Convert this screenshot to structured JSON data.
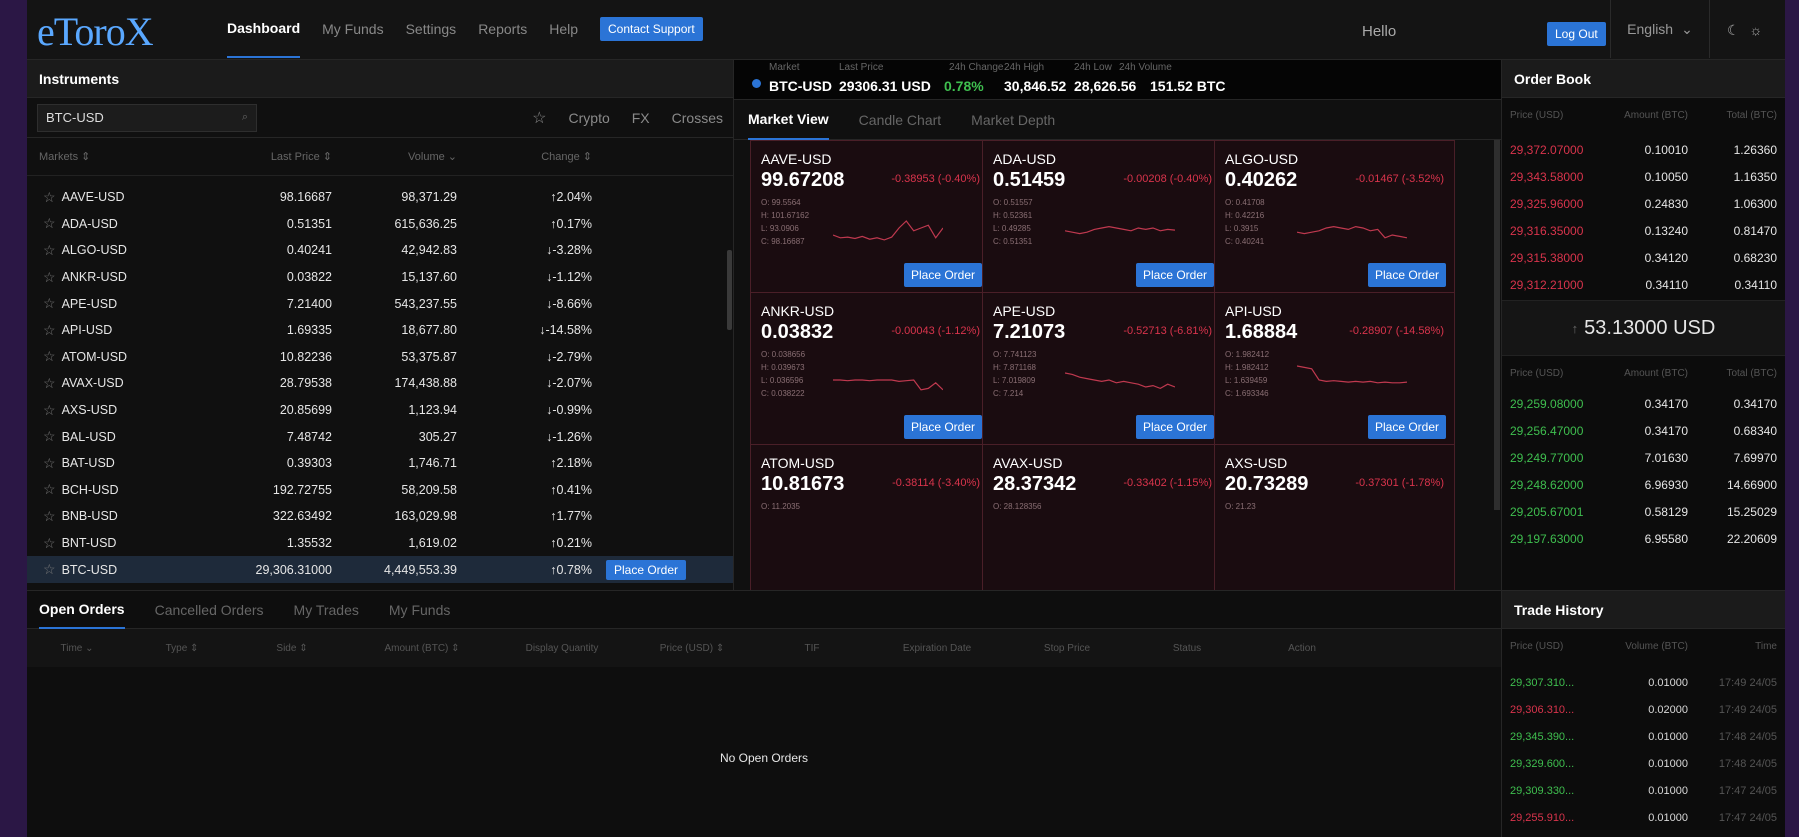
{
  "app": {
    "logo": "eToroX"
  },
  "nav": {
    "items": [
      "Dashboard",
      "My Funds",
      "Settings",
      "Reports",
      "Help"
    ],
    "contact": "Contact Support",
    "hello": "Hello",
    "logout": "Log Out",
    "language": "English"
  },
  "instruments": {
    "title": "Instruments",
    "search_value": "BTC-USD",
    "filters": [
      "Crypto",
      "FX",
      "Crosses"
    ],
    "columns": [
      "Markets ⇕",
      "Last Price ⇕",
      "Volume ⌄",
      "Change ⇕"
    ],
    "rows": [
      {
        "m": "AAVE-USD",
        "p": "98.16687",
        "v": "98,371.29",
        "c": "↑2.04%",
        "dir": "up"
      },
      {
        "m": "ADA-USD",
        "p": "0.51351",
        "v": "615,636.25",
        "c": "↑0.17%",
        "dir": "up"
      },
      {
        "m": "ALGO-USD",
        "p": "0.40241",
        "v": "42,942.83",
        "c": "↓-3.28%",
        "dir": "down"
      },
      {
        "m": "ANKR-USD",
        "p": "0.03822",
        "v": "15,137.60",
        "c": "↓-1.12%",
        "dir": "down"
      },
      {
        "m": "APE-USD",
        "p": "7.21400",
        "v": "543,237.55",
        "c": "↓-8.66%",
        "dir": "down"
      },
      {
        "m": "API-USD",
        "p": "1.69335",
        "v": "18,677.80",
        "c": "↓-14.58%",
        "dir": "down"
      },
      {
        "m": "ATOM-USD",
        "p": "10.82236",
        "v": "53,375.87",
        "c": "↓-2.79%",
        "dir": "down"
      },
      {
        "m": "AVAX-USD",
        "p": "28.79538",
        "v": "174,438.88",
        "c": "↓-2.07%",
        "dir": "down"
      },
      {
        "m": "AXS-USD",
        "p": "20.85699",
        "v": "1,123.94",
        "c": "↓-0.99%",
        "dir": "down"
      },
      {
        "m": "BAL-USD",
        "p": "7.48742",
        "v": "305.27",
        "c": "↓-1.26%",
        "dir": "down"
      },
      {
        "m": "BAT-USD",
        "p": "0.39303",
        "v": "1,746.71",
        "c": "↑2.18%",
        "dir": "up"
      },
      {
        "m": "BCH-USD",
        "p": "192.72755",
        "v": "58,209.58",
        "c": "↑0.41%",
        "dir": "up"
      },
      {
        "m": "BNB-USD",
        "p": "322.63492",
        "v": "163,029.98",
        "c": "↑1.77%",
        "dir": "up"
      },
      {
        "m": "BNT-USD",
        "p": "1.35532",
        "v": "1,619.02",
        "c": "↑0.21%",
        "dir": "up"
      },
      {
        "m": "BTC-USD",
        "p": "29,306.31000",
        "v": "4,449,553.39",
        "c": "↑0.78%",
        "dir": "up",
        "selected": true
      }
    ],
    "place_order": "Place Order"
  },
  "ticker": {
    "labels": [
      "Market",
      "Last Price",
      "24h Change",
      "24h High",
      "24h Low",
      "24h Volume"
    ],
    "market": "BTC-USD",
    "last_price": "29306.31 USD",
    "change": "0.78%",
    "high": "30,846.52",
    "low": "28,626.56",
    "volume": "151.52 BTC"
  },
  "market_view": {
    "tabs": [
      "Market View",
      "Candle Chart",
      "Market Depth"
    ],
    "cards": [
      {
        "sym": "AAVE-USD",
        "price": "99.67208",
        "chg": "-0.38953 (-0.40%)",
        "o": "O: 99.5564",
        "h": "H: 101.67162",
        "l": "L: 93.0906",
        "c": "C: 98.16687",
        "spark": [
          40,
          44,
          43,
          45,
          42,
          46,
          44,
          47,
          43,
          30,
          20,
          34,
          30,
          26,
          44,
          30
        ]
      },
      {
        "sym": "ADA-USD",
        "price": "0.51459",
        "chg": "-0.00208 (-0.40%)",
        "o": "O: 0.51557",
        "h": "H: 0.52361",
        "l": "L: 0.49285",
        "c": "C: 0.51351",
        "spark": [
          34,
          36,
          38,
          36,
          32,
          30,
          28,
          30,
          32,
          34,
          30,
          32,
          30,
          34,
          32,
          33
        ]
      },
      {
        "sym": "ALGO-USD",
        "price": "0.40262",
        "chg": "-0.01467 (-3.52%)",
        "o": "O: 0.41708",
        "h": "H: 0.42216",
        "l": "L: 0.3915",
        "c": "C: 0.40241",
        "spark": [
          36,
          38,
          36,
          34,
          30,
          28,
          30,
          32,
          28,
          30,
          34,
          32,
          44,
          40,
          42,
          44
        ]
      },
      {
        "sym": "ANKR-USD",
        "price": "0.03832",
        "chg": "-0.00043 (-1.12%)",
        "o": "O: 0.038656",
        "h": "H: 0.039673",
        "l": "L: 0.036596",
        "c": "C: 0.038222",
        "spark": [
          30,
          30,
          31,
          30,
          30,
          31,
          30,
          30,
          30,
          32,
          31,
          30,
          44,
          42,
          34,
          44
        ]
      },
      {
        "sym": "APE-USD",
        "price": "7.21073",
        "chg": "-0.52713 (-6.81%)",
        "o": "O: 7.741123",
        "h": "H: 7.871168",
        "l": "L: 7.019809",
        "c": "C: 7.214",
        "spark": [
          20,
          22,
          26,
          28,
          30,
          32,
          30,
          34,
          32,
          34,
          36,
          40,
          38,
          42,
          36,
          40
        ]
      },
      {
        "sym": "API-USD",
        "price": "1.68884",
        "chg": "-0.28907 (-14.58%)",
        "o": "O: 1.982412",
        "h": "H: 1.982412",
        "l": "L: 1.639459",
        "c": "C: 1.693346",
        "spark": [
          10,
          12,
          14,
          30,
          32,
          31,
          32,
          33,
          32,
          33,
          32,
          34,
          33,
          34,
          34,
          33
        ]
      },
      {
        "sym": "ATOM-USD",
        "price": "10.81673",
        "chg": "-0.38114 (-3.40%)",
        "o": "O: 11.2035",
        "h": "",
        "l": "",
        "c": "",
        "spark": []
      },
      {
        "sym": "AVAX-USD",
        "price": "28.37342",
        "chg": "-0.33402 (-1.15%)",
        "o": "O: 28.128356",
        "h": "",
        "l": "",
        "c": "",
        "spark": []
      },
      {
        "sym": "AXS-USD",
        "price": "20.73289",
        "chg": "-0.37301 (-1.78%)",
        "o": "O: 21.23",
        "h": "",
        "l": "",
        "c": "",
        "spark": []
      }
    ]
  },
  "order_book": {
    "title": "Order Book",
    "columns": [
      "Price (USD)",
      "Amount (BTC)",
      "Total (BTC)"
    ],
    "asks": [
      {
        "p": "29,372.07000",
        "a": "0.10010",
        "t": "1.26360"
      },
      {
        "p": "29,343.58000",
        "a": "0.10050",
        "t": "1.16350"
      },
      {
        "p": "29,325.96000",
        "a": "0.24830",
        "t": "1.06300"
      },
      {
        "p": "29,316.35000",
        "a": "0.13240",
        "t": "0.81470"
      },
      {
        "p": "29,315.38000",
        "a": "0.34120",
        "t": "0.68230"
      },
      {
        "p": "29,312.21000",
        "a": "0.34110",
        "t": "0.34110"
      }
    ],
    "spread": "53.13000 USD",
    "bids": [
      {
        "p": "29,259.08000",
        "a": "0.34170",
        "t": "0.34170"
      },
      {
        "p": "29,256.47000",
        "a": "0.34170",
        "t": "0.68340"
      },
      {
        "p": "29,249.77000",
        "a": "7.01630",
        "t": "7.69970"
      },
      {
        "p": "29,248.62000",
        "a": "6.96930",
        "t": "14.66900"
      },
      {
        "p": "29,205.67001",
        "a": "0.58129",
        "t": "15.25029"
      },
      {
        "p": "29,197.63000",
        "a": "6.95580",
        "t": "22.20609"
      }
    ]
  },
  "orders": {
    "tabs": [
      "Open Orders",
      "Cancelled Orders",
      "My Trades",
      "My Funds"
    ],
    "columns": [
      "Time ⌄",
      "Type ⇕",
      "Side ⇕",
      "Amount (BTC) ⇕",
      "Display Quantity",
      "Price (USD) ⇕",
      "TIF",
      "Expiration Date",
      "Stop Price",
      "Status",
      "Action"
    ],
    "empty": "No Open Orders"
  },
  "trade_history": {
    "title": "Trade History",
    "columns": [
      "Price (USD)",
      "Volume (BTC)",
      "Time"
    ],
    "rows": [
      {
        "p": "29,307.310...",
        "v": "0.01000",
        "t": "17:49 24/05",
        "dir": "up"
      },
      {
        "p": "29,306.310...",
        "v": "0.02000",
        "t": "17:49 24/05",
        "dir": "down"
      },
      {
        "p": "29,345.390...",
        "v": "0.01000",
        "t": "17:48 24/05",
        "dir": "up"
      },
      {
        "p": "29,329.600...",
        "v": "0.01000",
        "t": "17:48 24/05",
        "dir": "up"
      },
      {
        "p": "29,309.330...",
        "v": "0.01000",
        "t": "17:47 24/05",
        "dir": "up"
      },
      {
        "p": "29,255.910...",
        "v": "0.01000",
        "t": "17:47 24/05",
        "dir": "down"
      }
    ]
  },
  "colors": {
    "accent": "#2b74d6",
    "up": "#3fbf4f",
    "down": "#d9344c",
    "background": "#101010"
  }
}
